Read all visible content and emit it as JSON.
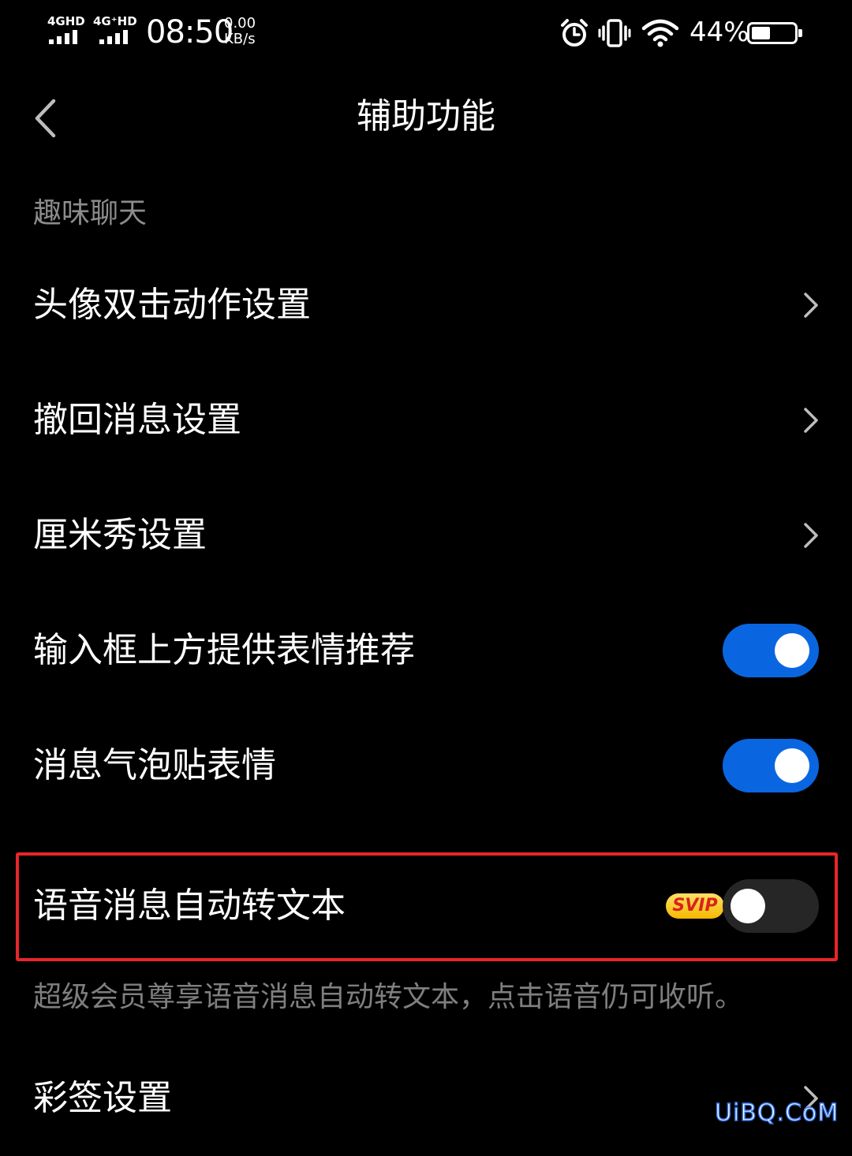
{
  "status_bar": {
    "sim1_network": "4GHD",
    "sim2_network": "4G⁺HD",
    "time": "08:50",
    "net_speed_value": "0.00",
    "net_speed_unit": "KB/s",
    "battery_percent": "44%",
    "battery_level": 0.44,
    "icons": [
      "alarm-icon",
      "vibrate-icon",
      "wifi-icon",
      "battery-icon"
    ]
  },
  "header": {
    "title": "辅助功能",
    "back_icon": "chevron-left-icon"
  },
  "section": {
    "title": "趣味聊天"
  },
  "items": [
    {
      "label": "头像双击动作设置",
      "control": "chevron"
    },
    {
      "label": "撤回消息设置",
      "control": "chevron"
    },
    {
      "label": "厘米秀设置",
      "control": "chevron"
    },
    {
      "label": "输入框上方提供表情推荐",
      "control": "toggle",
      "state": "on"
    },
    {
      "label": "消息气泡贴表情",
      "control": "toggle",
      "state": "on"
    },
    {
      "label": "语音消息自动转文本",
      "control": "toggle",
      "state": "off",
      "badge": "SVIP",
      "highlighted": true
    },
    {
      "label": "彩签设置",
      "control": "chevron"
    }
  ],
  "description": "超级会员尊享语音消息自动转文本，点击语音仍可收听。",
  "watermark": "UiBQ.CoM",
  "colors": {
    "background": "#000000",
    "toggle_on": "#0a66e0",
    "toggle_off": "#262626",
    "highlight": "#e8262a",
    "secondary_text": "#8c8c8c"
  }
}
